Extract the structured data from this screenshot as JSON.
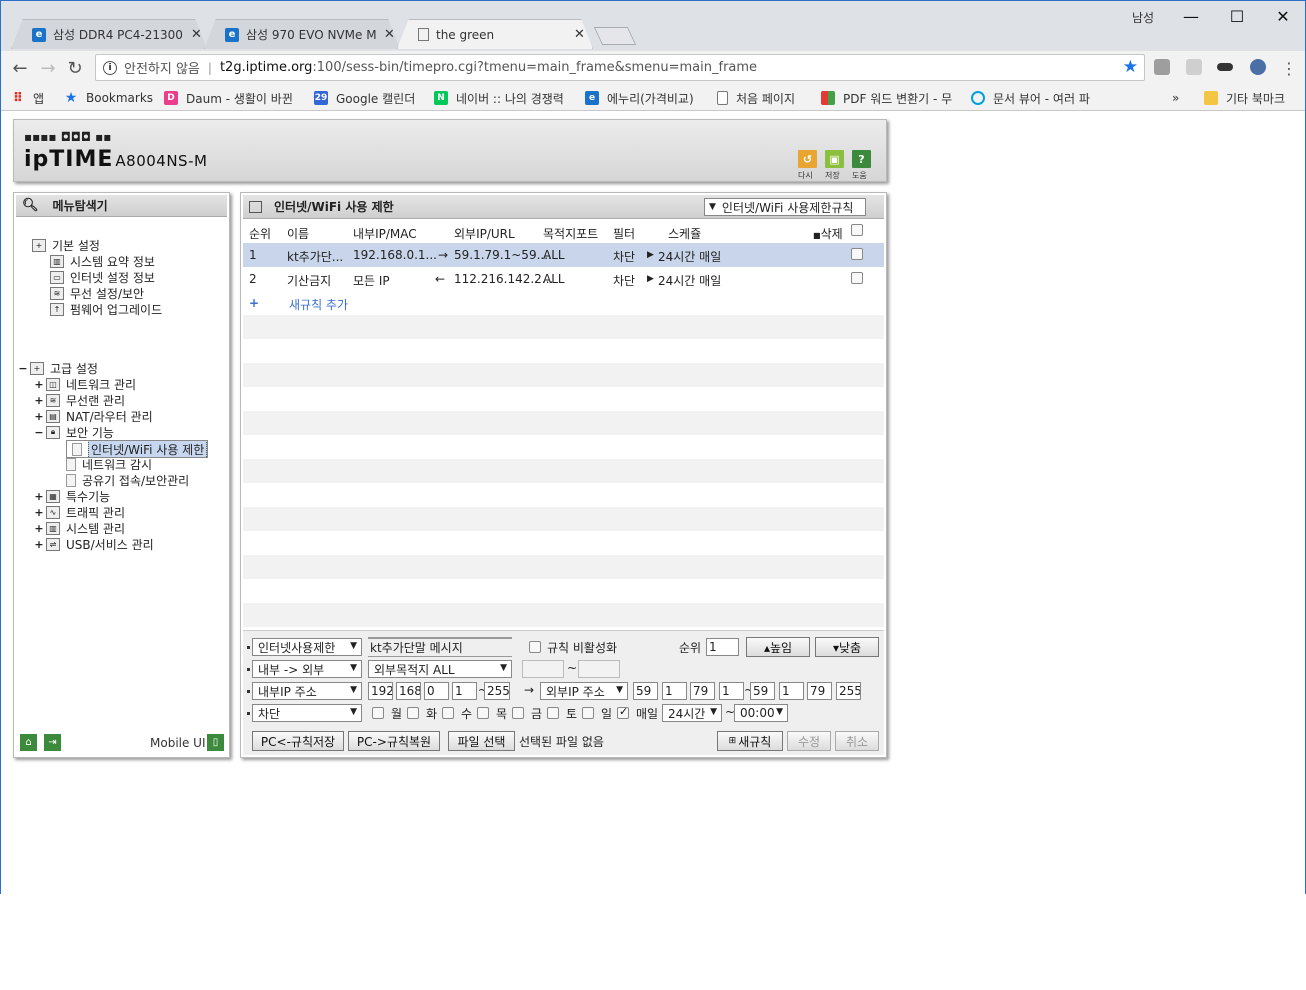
{
  "browser": {
    "tabs": [
      {
        "title": "삼성 DDR4 PC4-21300 [",
        "icon": "blue-e-icon",
        "close": "✕"
      },
      {
        "title": "삼성 970 EVO NVMe M.",
        "icon": "blue-e-icon",
        "close": "✕"
      },
      {
        "title": "the green",
        "icon": "document-icon",
        "close": "✕"
      }
    ],
    "user_label": "남성",
    "window_controls": {
      "minimize": "—",
      "maximize": "☐",
      "close": "✕"
    },
    "security_label": "안전하지 않음",
    "url_host": "t2g.iptime.org",
    "url_rest": ":100/sess-bin/timepro.cgi?tmenu=main_frame&smenu=main_frame",
    "bookmarks": [
      {
        "label": "앱",
        "icon": "apps-grid-icon",
        "color": "#d93025"
      },
      {
        "label": "Bookmarks",
        "icon": "star-icon",
        "color": "#1a73e8"
      },
      {
        "label": "Daum - 생활이 바뀐",
        "icon": "daum-icon",
        "color": "#e83e8c"
      },
      {
        "label": "Google 캘린더",
        "icon": "calendar-icon",
        "color": "#3367d6"
      },
      {
        "label": "네이버 :: 나의 경쟁력",
        "icon": "naver-icon",
        "color": "#03c75a"
      },
      {
        "label": "에누리(가격비교)",
        "icon": "enuri-icon",
        "color": "#1a73c8"
      },
      {
        "label": "처음 페이지",
        "icon": "document-icon",
        "color": "#777777"
      },
      {
        "label": "PDF 워드 변환기 - 무",
        "icon": "pdf-converter-icon",
        "color": "#e53935"
      },
      {
        "label": "문서 뷰어 - 여러 파",
        "icon": "viewer-icon",
        "color": "#00a3d9"
      },
      {
        "label": "»",
        "icon": "more-icon",
        "color": "#333333"
      },
      {
        "label": "기타 북마크",
        "icon": "folder-icon",
        "color": "#f4c542"
      }
    ]
  },
  "router": {
    "logo_dots": "▪▪▪▪ ◘◘◘ ▪▪",
    "logo": "ipTIME",
    "model": "A8004NS-M",
    "top_buttons": [
      {
        "label": "다시",
        "icon": "refresh-icon",
        "color": "#e8a531"
      },
      {
        "label": "저장",
        "icon": "save-icon",
        "color": "#8cbf3f"
      },
      {
        "label": "도움",
        "icon": "help-icon",
        "color": "#3c8a3c"
      }
    ],
    "menu": {
      "title": "메뉴탐색기",
      "basic": {
        "label": "기본 설정",
        "items": [
          "시스템 요약 정보",
          "인터넷 설정 정보",
          "무선 설정/보안",
          "펌웨어 업그레이드"
        ]
      },
      "advanced": {
        "label": "고급 설정",
        "items": [
          {
            "label": "네트워크 관리",
            "exp": "+"
          },
          {
            "label": "무선랜 관리",
            "exp": "+"
          },
          {
            "label": "NAT/라우터 관리",
            "exp": "+"
          },
          {
            "label": "보안 기능",
            "exp": "−"
          },
          {
            "label": "특수기능",
            "exp": "+"
          },
          {
            "label": "트래픽 관리",
            "exp": "+"
          },
          {
            "label": "시스템 관리",
            "exp": "+"
          },
          {
            "label": "USB/서비스 관리",
            "exp": "+"
          }
        ],
        "security_items": [
          "인터넷/WiFi 사용 제한",
          "네트워크 감시",
          "공유기 접속/보안관리"
        ]
      },
      "mobile_ui": "Mobile UI"
    },
    "main": {
      "title": "인터넷/WiFi 사용 제한",
      "rule_select": "인터넷/WiFi 사용제한규칙",
      "columns": {
        "order": "순위",
        "name": "이름",
        "inner": "내부IP/MAC",
        "outer": "외부IP/URL",
        "port": "목적지포트",
        "filter": "필터",
        "schedule": "스케쥴",
        "delete": "삭제"
      },
      "rows": [
        {
          "order": "1",
          "name": "kt추가단...",
          "inner": "192.168.0.1...",
          "dir": "→",
          "outer": "59.1.79.1~59....",
          "port": "ALL",
          "filter": "차단",
          "schedule": "24시간 매일"
        },
        {
          "order": "2",
          "name": "기산금지",
          "inner": "모든 IP",
          "dir": "←",
          "outer": "112.216.142.2...",
          "port": "ALL",
          "filter": "차단",
          "schedule": "24시간 매일"
        }
      ],
      "add_rule": "새규칙 추가"
    },
    "edit": {
      "type": "인터넷사용제한",
      "message": "kt추가단말 메시지",
      "disable_label": "규칙 비활성화",
      "order_label": "순위",
      "order_value": "1",
      "up_button": "▴높임",
      "down_button": "▾낮춤",
      "direction": "내부 -> 외부",
      "dest_port": "외부목적지 ALL",
      "tilde": "~",
      "inner_type": "내부IP 주소",
      "inner_ip": [
        "192",
        "168",
        "0",
        "1"
      ],
      "inner_end": "255",
      "arrow": "→",
      "outer_type": "외부IP 주소",
      "outer_ip_start": [
        "59",
        "1",
        "79",
        "1"
      ],
      "outer_ip_end": [
        "59",
        "1",
        "79",
        "255"
      ],
      "action": "차단",
      "days": [
        "월",
        "화",
        "수",
        "목",
        "금",
        "토",
        "일"
      ],
      "everyday": "매일",
      "hours": "24시간",
      "time_end": "00:00",
      "save_pc": "PC<-규칙저장",
      "restore_pc": "PC->규칙복원",
      "file_select": "파일 선택",
      "no_file": "선택된 파일 없음",
      "new_rule": "새규칙",
      "modify": "수정",
      "cancel": "취소"
    }
  }
}
